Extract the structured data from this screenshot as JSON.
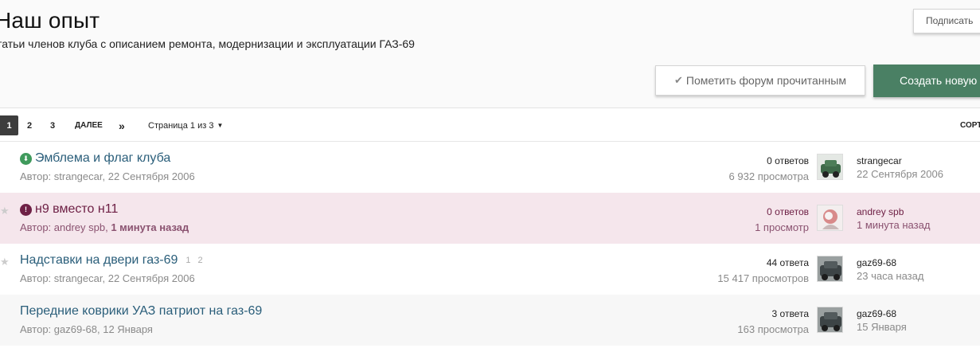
{
  "header": {
    "title": "Наш опыт",
    "description": "татьи членов клуба с описанием ремонта, модернизации и эксплуатации ГАЗ-69",
    "follow_label": "Подписать",
    "mark_read_label": "Пометить форум прочитанным",
    "create_label": "Создать новую"
  },
  "pagination": {
    "pages": [
      "1",
      "2",
      "3"
    ],
    "active": "1",
    "next_label": "ДАЛЕЕ",
    "last_icon": "»",
    "page_status": "Страница 1 из 3",
    "sort_label": "СОРТ"
  },
  "topics": [
    {
      "title": "Эмблема и флаг клуба",
      "badge": "pin-icon",
      "author_prefix": "Автор: strangecar, ",
      "date": "22 Сентября 2006",
      "replies": "0 ответов",
      "views": "6 932 просмотра",
      "last_poster": "strangecar",
      "last_time": "22 Сентября 2006",
      "unread": false,
      "mini_pages": []
    },
    {
      "title": "н9 вместо н11",
      "badge": "warning-icon",
      "author_prefix": "Автор: andrey spb, ",
      "date": "1 минута назад",
      "replies": "0 ответов",
      "views": "1 просмотр",
      "last_poster": "andrey spb",
      "last_time": "1 минута назад",
      "unread": true,
      "mini_pages": []
    },
    {
      "title": "Надставки на двери газ-69",
      "badge": "",
      "author_prefix": "Автор: strangecar, ",
      "date": "22 Сентября 2006",
      "replies": "44 ответа",
      "views": "15 417 просмотров",
      "last_poster": "gaz69-68",
      "last_time": "23 часа назад",
      "unread": false,
      "mini_pages": [
        "1",
        "2"
      ]
    },
    {
      "title": "Передние коврики УАЗ патриот на газ-69",
      "badge": "",
      "author_prefix": "Автор: gaz69-68, ",
      "date": "12 Января",
      "replies": "3 ответа",
      "views": "163 просмотра",
      "last_poster": "gaz69-68",
      "last_time": "15 Января",
      "unread": false,
      "mini_pages": []
    }
  ],
  "colors": {
    "accent_green": "#4a8064",
    "unread_bg": "#f5e6ec",
    "unread_text": "#6e2045",
    "link": "#2a5e7a"
  }
}
